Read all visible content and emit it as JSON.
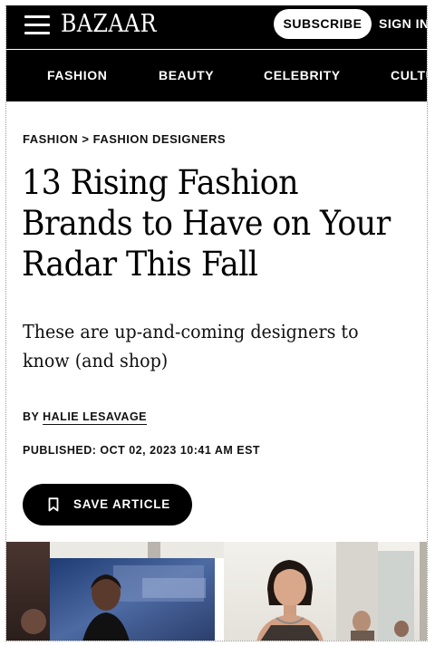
{
  "header": {
    "logo": "BAZAAR",
    "subscribe_label": "SUBSCRIBE",
    "signin_label": "SIGN IN"
  },
  "nav": {
    "items": [
      "FASHION",
      "BEAUTY",
      "CELEBRITY",
      "CULTURE"
    ]
  },
  "breadcrumb": {
    "parent": "FASHION",
    "separator": ">",
    "current": "FASHION DESIGNERS"
  },
  "article": {
    "title": "13 Rising Fashion Brands to Have on Your Radar This Fall",
    "dek": "These are up-and-coming designers to know (and shop)",
    "byline_prefix": "BY",
    "author": "HALIE LESAVAGE",
    "published": "PUBLISHED: OCT 02, 2023 10:41 AM EST",
    "save_label": "SAVE ARTICLE"
  },
  "icons": {
    "menu": "hamburger-menu-icon",
    "bookmark": "bookmark-icon"
  },
  "colors": {
    "header_bg": "#000000",
    "text": "#000000",
    "button_bg": "#000000",
    "button_text": "#ffffff"
  }
}
